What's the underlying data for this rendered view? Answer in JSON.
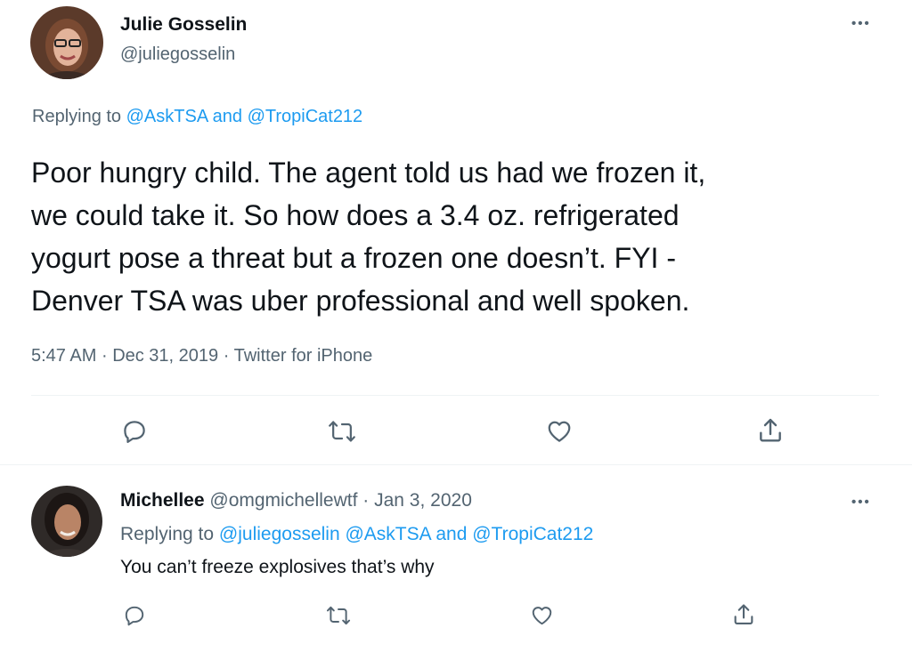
{
  "main_tweet": {
    "author_name": "Julie Gosselin",
    "handle": "@juliegosselin",
    "more": "•••",
    "replying_label": "Replying to",
    "reply_mentions": [
      "@AskTSA",
      "@TropiCat212"
    ],
    "reply_joiner": "and",
    "text_lines": [
      "Poor hungry child.  The agent told us had we frozen it,",
      "we could take it.  So how does a 3.4 oz. refrigerated",
      "yogurt pose a threat but a frozen one doesn’t. FYI -",
      "Denver TSA was uber professional and well spoken."
    ],
    "time": "5:47 AM",
    "date": "Dec 31, 2019",
    "source": "Twitter for iPhone",
    "separator": "·"
  },
  "reply_tweet": {
    "author_name": "Michellee",
    "handle": "@omgmichellewtf",
    "separator": "·",
    "date": "Jan 3, 2020",
    "more": "•••",
    "replying_label": "Replying to",
    "reply_mentions": [
      "@juliegosselin",
      "@AskTSA",
      "@TropiCat212"
    ],
    "reply_joiner": "and",
    "text": "You can’t freeze explosives that’s why"
  },
  "icons": {
    "reply": "reply-icon",
    "retweet": "retweet-icon",
    "like": "like-icon",
    "share": "share-icon",
    "more": "more-icon"
  },
  "colors": {
    "link": "#1d9bf0",
    "muted": "#536471",
    "text": "#0f1419",
    "divider": "#eff3f4"
  }
}
